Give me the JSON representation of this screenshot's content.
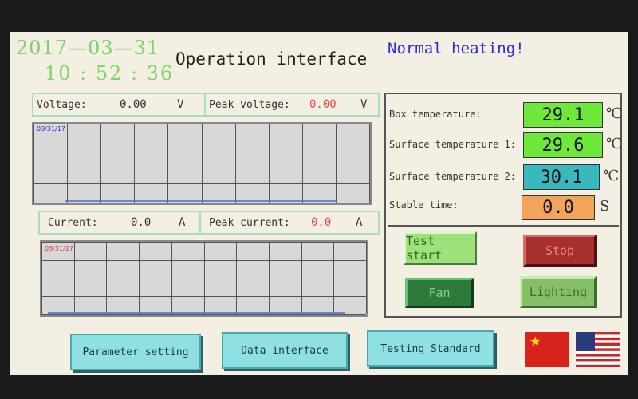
{
  "header": {
    "date": "2017—03—31",
    "time": "10 : 52 : 36",
    "title": "Operation interface",
    "status": "Normal heating!"
  },
  "voltage": {
    "label": "Voltage:",
    "value": "0.00",
    "unit": "V",
    "peak_label": "Peak voltage:",
    "peak_value": "0.00",
    "peak_unit": "V",
    "chart_date": "03/31/17"
  },
  "current": {
    "label": "Current:",
    "value": "0.0",
    "unit": "A",
    "peak_label": "Peak current:",
    "peak_value": "0.0",
    "peak_unit": "A",
    "chart_date": "03/31/17"
  },
  "temps": {
    "box_label": "Box temperature:",
    "box_value": "29.1",
    "surf1_label": "Surface temperature 1:",
    "surf1_value": "29.6",
    "surf2_label": "Surface temperature 2:",
    "surf2_value": "30.1",
    "stable_label": "Stable time:",
    "stable_value": "0.0",
    "temp_unit": "℃",
    "time_unit": "S"
  },
  "controls": {
    "test_start": "Test start",
    "stop": "Stop",
    "fan": "Fan",
    "lighting": "Lighting"
  },
  "footer": {
    "parameter_setting": "Parameter setting",
    "data_interface": "Data interface",
    "testing_standard": "Testing Standard"
  },
  "colors": {
    "green_display": "#6ee83a",
    "cyan_display": "#3ab8c0",
    "orange_display": "#f2a45a",
    "button_blue": "#8fe0e2"
  }
}
